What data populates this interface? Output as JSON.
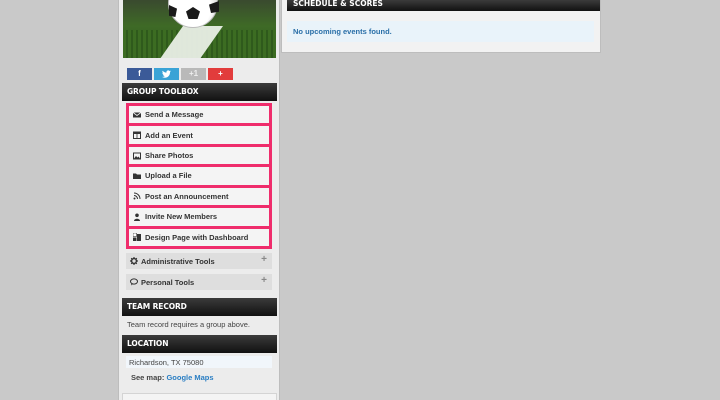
{
  "social": {
    "facebook": "f",
    "twitter": "",
    "googleplus": "+1",
    "add": "+"
  },
  "toolbox": {
    "title": "GROUP TOOLBOX",
    "highlight_color": "#ef2d6c",
    "items": [
      {
        "label": "Send a Message",
        "icon": "envelope-icon"
      },
      {
        "label": "Add an Event",
        "icon": "calendar-icon"
      },
      {
        "label": "Share Photos",
        "icon": "photo-icon"
      },
      {
        "label": "Upload a File",
        "icon": "folder-icon"
      },
      {
        "label": "Post an Announcement",
        "icon": "rss-icon"
      },
      {
        "label": "Invite New Members",
        "icon": "person-icon"
      },
      {
        "label": "Design Page with Dashboard",
        "icon": "dashboard-icon"
      }
    ],
    "collapsibles": [
      {
        "label": "Administrative Tools",
        "icon": "gear-icon",
        "toggle": "+"
      },
      {
        "label": "Personal Tools",
        "icon": "chat-icon",
        "toggle": "+"
      }
    ]
  },
  "team_record": {
    "title": "TEAM RECORD",
    "text": "Team record requires a group above."
  },
  "location": {
    "title": "LOCATION",
    "address": "Richardson, TX 75080",
    "see_map_label": "See map:",
    "map_link": "Google Maps"
  },
  "schedule": {
    "title": "SCHEDULE & SCORES",
    "empty_text": "No upcoming events found."
  }
}
